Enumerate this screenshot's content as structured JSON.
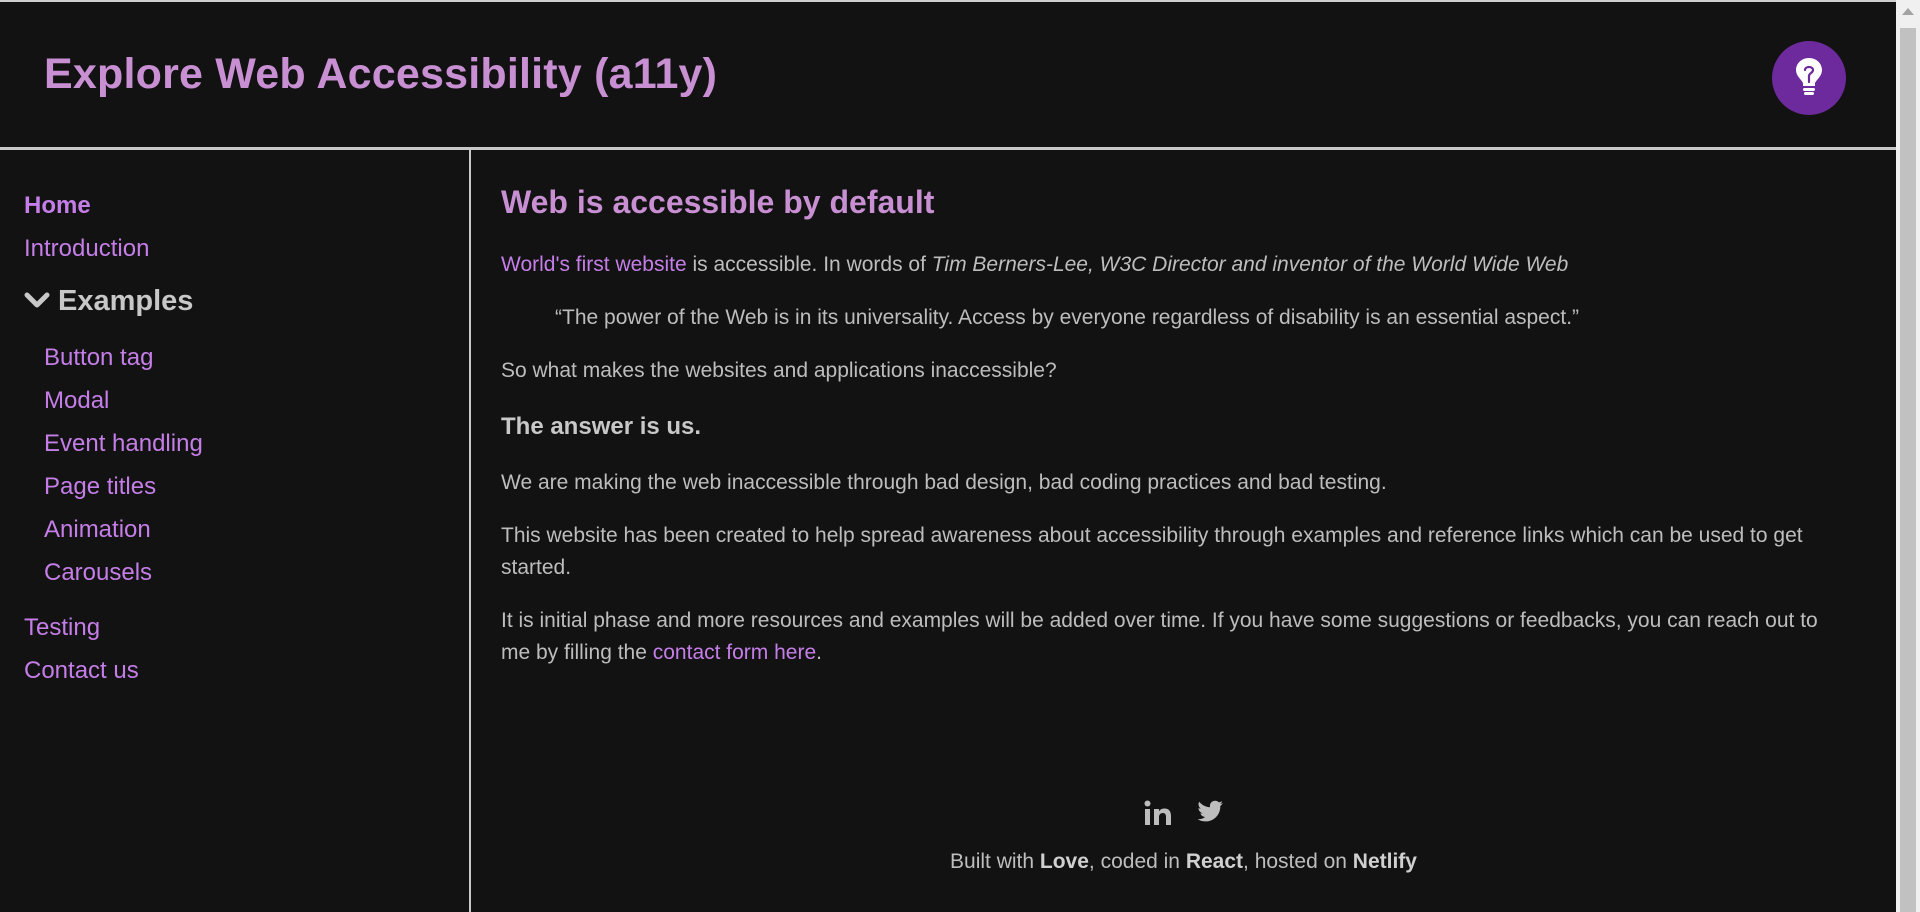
{
  "header": {
    "title": "Explore Web Accessibility (a11y)",
    "theme_toggle_icon": "lightbulb-icon",
    "accent_color": "#6c2a9c"
  },
  "sidebar": {
    "items": [
      {
        "label": "Home"
      },
      {
        "label": "Introduction"
      }
    ],
    "group": {
      "label": "Examples",
      "icon": "chevron-down-icon",
      "items": [
        {
          "label": "Button tag"
        },
        {
          "label": "Modal"
        },
        {
          "label": "Event handling"
        },
        {
          "label": "Page titles"
        },
        {
          "label": "Animation"
        },
        {
          "label": "Carousels"
        }
      ]
    },
    "after_items": [
      {
        "label": "Testing"
      },
      {
        "label": "Contact us"
      }
    ]
  },
  "main": {
    "heading": "Web is accessible by default",
    "intro_link": "World's first website",
    "intro_text": " is accessible. In words of ",
    "intro_attribution": "Tim Berners-Lee, W3C Director and inventor of the World Wide Web",
    "quote": "“The power of the Web is in its universality. Access by everyone regardless of disability is an essential aspect.”",
    "question": "So what makes the websites and applications inaccessible?",
    "answer_heading": "The answer is us.",
    "para1": "We are making the web inaccessible through bad design, bad coding practices and bad testing.",
    "para2": "This website has been created to help spread awareness about accessibility through examples and reference links which can be used to get started.",
    "para3_text": "It is initial phase and more resources and examples will be added over time. If you have some suggestions or feedbacks, you can reach out to me by filling the ",
    "para3_link": "contact form here",
    "para3_end": "."
  },
  "footer": {
    "social": [
      "linkedin-icon",
      "twitter-icon"
    ],
    "built_prefix": "Built with ",
    "love": "Love",
    "coded_prefix": ", coded in ",
    "react": "React",
    "hosted_prefix": ", hosted on ",
    "netlify": "Netlify"
  }
}
